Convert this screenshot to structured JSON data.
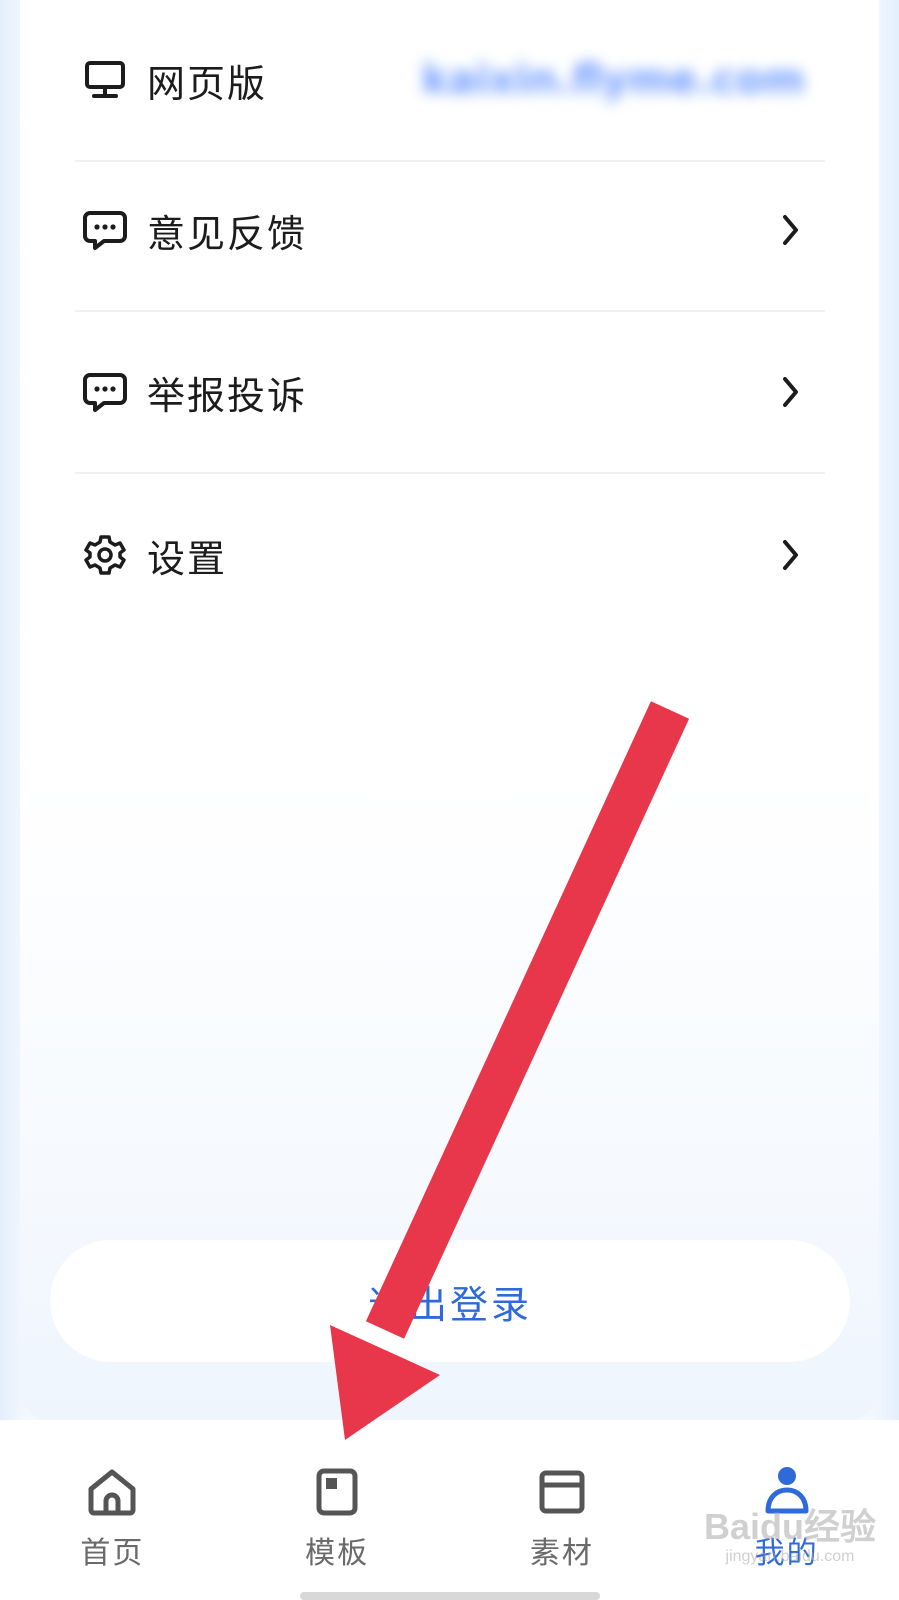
{
  "menu": {
    "items": [
      {
        "label": "网页版",
        "value": "kaixin.flyme.com",
        "icon": "monitor-icon"
      },
      {
        "label": "意见反馈",
        "icon": "message-bubble-icon"
      },
      {
        "label": "举报投诉",
        "icon": "message-bubble-icon"
      },
      {
        "label": "设置",
        "icon": "gear-icon"
      }
    ]
  },
  "logout_label": "退出登录",
  "tabs": [
    {
      "label": "首页",
      "icon": "home-icon",
      "active": false
    },
    {
      "label": "模板",
      "icon": "template-icon",
      "active": false
    },
    {
      "label": "素材",
      "icon": "folder-icon",
      "active": false
    },
    {
      "label": "我的",
      "icon": "profile-icon",
      "active": true
    }
  ],
  "annotation": {
    "color": "#e8364a"
  },
  "watermark": {
    "main": "Baidu经验",
    "sub": "jingyan.baidu.com"
  },
  "colors": {
    "accent": "#2f6bd8",
    "text": "#1c1c1c"
  }
}
